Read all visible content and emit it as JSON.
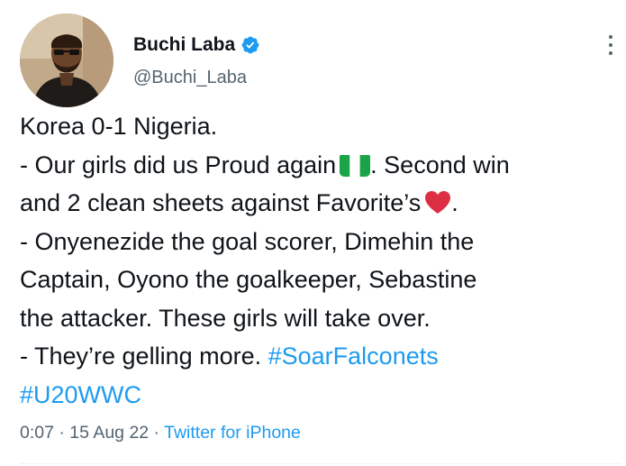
{
  "author": {
    "display_name": "Buchi Laba",
    "handle": "@Buchi_Laba",
    "verified": true
  },
  "tweet": {
    "lines": [
      {
        "text": "Korea 0-1 Nigeria."
      },
      {
        "text": "- Our girls did us Proud again",
        "emoji": "flag-nigeria",
        "after": ". Second win"
      },
      {
        "text": "and 2 clean sheets against Favorite’s",
        "emoji": "red-heart",
        "after": "."
      },
      {
        "text": "- Onyenezide the goal scorer, Dimehin the"
      },
      {
        "text": "Captain, Oyono the goalkeeper, Sebastine"
      },
      {
        "text": "the attacker. These girls will take over."
      },
      {
        "text": "- They’re gelling more. ",
        "hashtag": "#SoarFalconets"
      },
      {
        "hashtag": "#U20WWC"
      }
    ]
  },
  "meta": {
    "time": "0:07",
    "separator": " · ",
    "date": "15 Aug 22",
    "source": "Twitter for iPhone"
  },
  "colors": {
    "link": "#1d9bf0",
    "secondary_text": "#536471",
    "primary_text": "#0f1419",
    "verified_badge": "#1d9bf0"
  },
  "icons": {
    "verified": "verified-badge-icon",
    "more": "more-options-icon"
  }
}
